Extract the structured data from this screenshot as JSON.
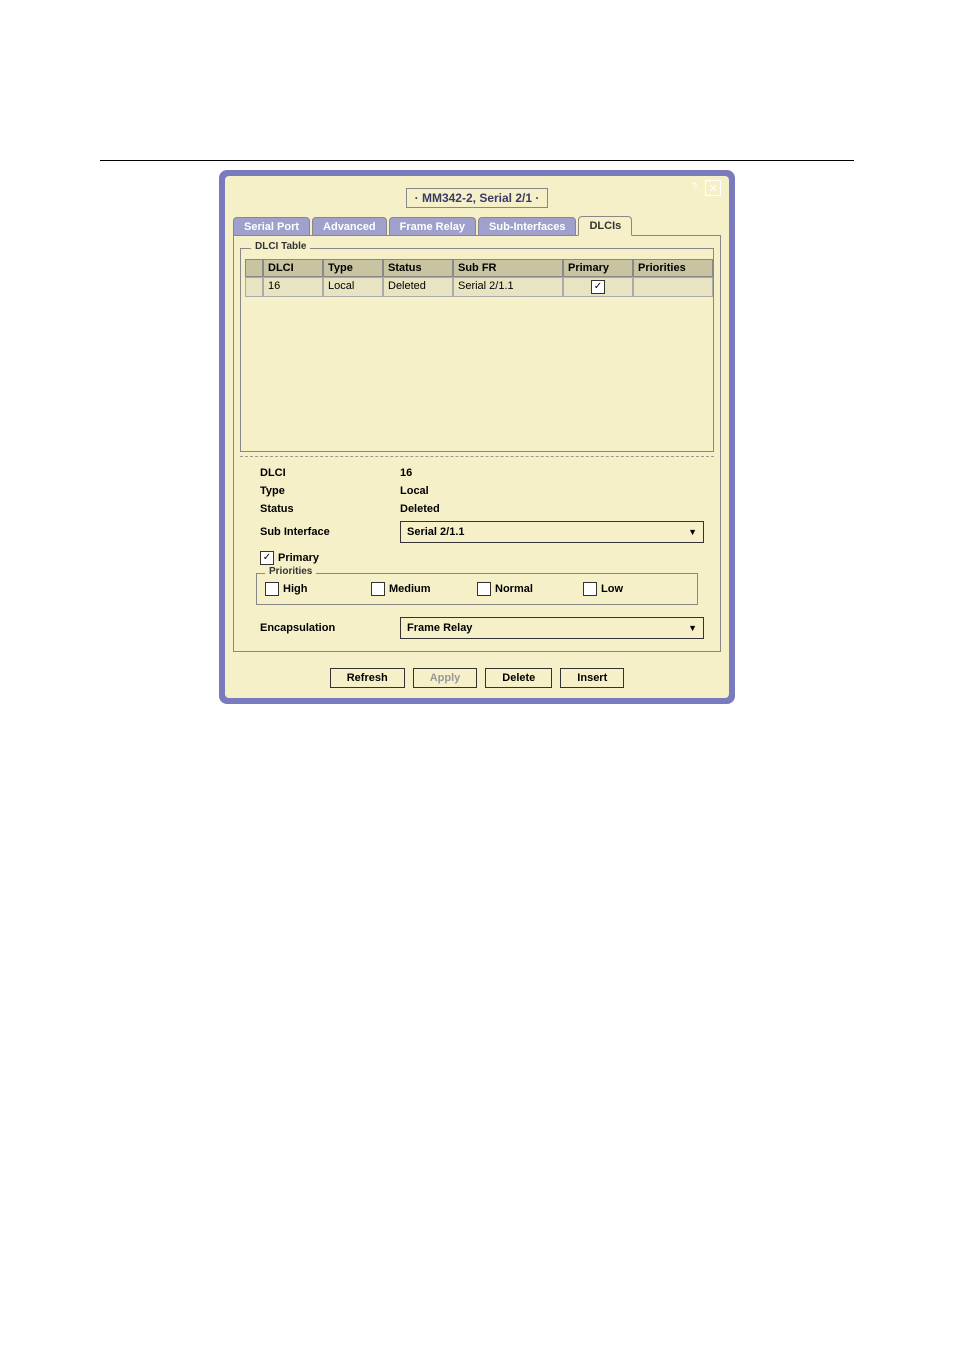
{
  "window": {
    "title": "· MM342-2, Serial 2/1 ·"
  },
  "tabs": {
    "t0": "Serial Port",
    "t1": "Advanced",
    "t2": "Frame Relay",
    "t3": "Sub-Interfaces",
    "t4": "DLCIs"
  },
  "fieldset": {
    "table_label": "DLCI Table",
    "priorities_label": "Priorities"
  },
  "table": {
    "headers": {
      "dlci": "DLCI",
      "type": "Type",
      "status": "Status",
      "subfr": "Sub FR",
      "primary": "Primary",
      "priorities": "Priorities"
    },
    "row0": {
      "dlci": "16",
      "type": "Local",
      "status": "Deleted",
      "subfr": "Serial 2/1.1",
      "primary_checked": "✓",
      "priorities": ""
    }
  },
  "details": {
    "dlci_label": "DLCI",
    "dlci_value": "16",
    "type_label": "Type",
    "type_value": "Local",
    "status_label": "Status",
    "status_value": "Deleted",
    "subif_label": "Sub Interface",
    "subif_value": "Serial 2/1.1",
    "primary_label": "Primary",
    "encap_label": "Encapsulation",
    "encap_value": "Frame Relay"
  },
  "priorities": {
    "high": "High",
    "medium": "Medium",
    "normal": "Normal",
    "low": "Low"
  },
  "buttons": {
    "refresh": "Refresh",
    "apply": "Apply",
    "delete": "Delete",
    "insert": "Insert"
  }
}
